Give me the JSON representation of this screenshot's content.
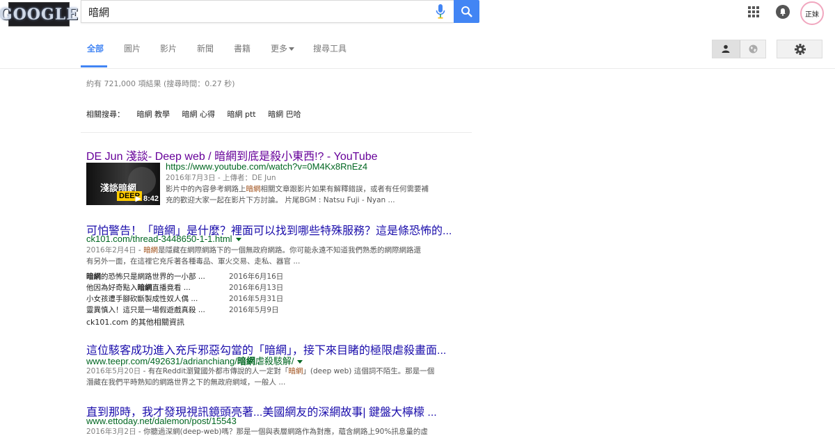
{
  "header": {
    "logo_text": "GOOGLE",
    "search_value": "暗網",
    "avatar_text": "正妹",
    "icons": [
      "mic-icon",
      "search-icon",
      "apps-icon",
      "notifications-icon"
    ]
  },
  "tabs": [
    {
      "label": "全部",
      "active": true
    },
    {
      "label": "圖片"
    },
    {
      "label": "影片"
    },
    {
      "label": "新聞"
    },
    {
      "label": "書籍"
    },
    {
      "label": "更多"
    },
    {
      "label": "搜尋工具"
    }
  ],
  "stats": "約有 721,000 項結果 (搜尋時間：0.27 秒)",
  "related": {
    "label": "相關搜尋：",
    "items": [
      "暗網 教學",
      "暗網 心得",
      "暗網 ptt",
      "暗網 巴哈"
    ]
  },
  "results": [
    {
      "title": "DE Jun 淺談- Deep web / 暗網到底是殺小東西!? - YouTube",
      "url": "https://www.youtube.com/watch?v=0M4Kx8RnEz4",
      "meta": "2016年7月3日 - 上傳者：DE Jun",
      "snippet_1a": "影片中的內容參考網路上",
      "snippet_1b": "暗網",
      "snippet_1c": "相關文章跟影片如果有解釋錯誤，或者有任何需要補",
      "snippet_2": "充的歡迎大家一起在影片下方討論。 片尾BGM : Natsu Fuji - Nyan ...",
      "thumb_text": "淺談暗網",
      "thumb_label": "DEEP",
      "thumb_duration": "8:42"
    },
    {
      "title": "可怕警告！「暗網」是什麼？裡面可以找到哪些特殊服務？這是條恐怖的...",
      "url": "ck101.com/thread-3448650-1-1.html",
      "date": "2016年2月4日",
      "snippet_1a": "暗網",
      "snippet_1b": "是隱藏在網際網路下的一個無政府網路。你可能永遠不知道我們熟悉的網際網路還",
      "snippet_2": "有另外一面，在這裡它充斥著各種毒品、軍火交易、走私、器官 ...",
      "sub": [
        {
          "a": "暗網",
          "b": "的恐怖只是網路世界的一小部 ...",
          "date": "2016年6月16日"
        },
        {
          "a": "他因為好奇點入",
          "b": "暗網",
          "c": "直播竟看 ...",
          "date": "2016年6月13日"
        },
        {
          "a": "小女孩遭手腳砍斷製成性奴人偶 ...",
          "date": "2016年5月31日"
        },
        {
          "a": "靈異慎入！這只是一場假遊戲真殺 ...",
          "date": "2016年5月9日"
        }
      ],
      "more": "ck101.com 的其他相關資訊"
    },
    {
      "title": "這位駭客成功進入充斥邪惡勾當的「暗網」，接下來目睹的極限虐殺畫面...",
      "url_a": "www.teepr.com/492631/adrianchiang/",
      "url_b": "暗網",
      "url_c": "虐殺駭解/",
      "date": "2016年5月20日",
      "snippet_1a": "有在Reddit瀏覽國外都市傳說的人一定對「",
      "snippet_1b": "暗網",
      "snippet_1c": "」(deep web) 這個詞不陌生。那是一個",
      "snippet_2": "潛藏在我們平時熟知的網路世界之下的無政府網域，一般人 ..."
    },
    {
      "title": "直到那時，我才發現視訊鏡頭亮著...美國網友的深網故事| 鍵盤大檸檬 ...",
      "url": "www.ettoday.net/dalemon/post/15543",
      "date": "2016年3月2日",
      "snippet_1": "你聽過深網(deep-web)嗎？那是一個與表層網路作為對應，蘊含網路上90%訊息量的虛"
    }
  ],
  "colors": {
    "link": "#1a0dab",
    "visited": "#660099",
    "url": "#006621",
    "accent": "#4285f4",
    "snippet": "#545454"
  }
}
